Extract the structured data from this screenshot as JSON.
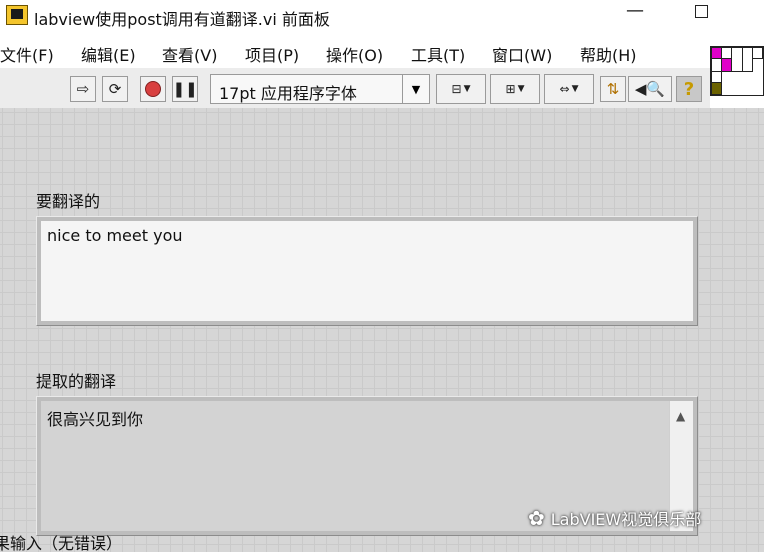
{
  "window": {
    "title": "labview使用post调用有道翻译.vi 前面板",
    "minimize_glyph": "—"
  },
  "menu": [
    "文件(F)",
    "编辑(E)",
    "查看(V)",
    "项目(P)",
    "操作(O)",
    "工具(T)",
    "窗口(W)",
    "帮助(H)"
  ],
  "toolbar": {
    "run_icon": "run-arrow-icon",
    "run_continuous_icon": "run-continuously-icon",
    "abort_icon": "abort-stop-icon",
    "pause_icon": "pause-icon",
    "font_select": "17pt 应用程序字体",
    "align_icon": "align-objects-icon",
    "distribute_icon": "distribute-objects-icon",
    "resize_icon": "resize-objects-icon",
    "reorder_icon": "reorder-icon",
    "search_icon": "search-icon",
    "help_icon": "context-help-icon",
    "help_glyph": "?"
  },
  "front_panel": {
    "control_label": "要翻译的",
    "control_value": "nice to meet you",
    "indicator_label": "提取的翻译",
    "indicator_value": "很高兴见到你",
    "bottom_label": "果输入（无错误）"
  },
  "watermark": {
    "text": "LabVIEW视觉俱乐部"
  },
  "colors": {
    "canvas_bg": "#d6d6d6",
    "grid_line": "#cacaca",
    "control_bg": "#f5f5f5",
    "indicator_bg": "#d3d3d3",
    "palette_magenta": "#e000c8",
    "palette_olive": "#6b6200"
  }
}
